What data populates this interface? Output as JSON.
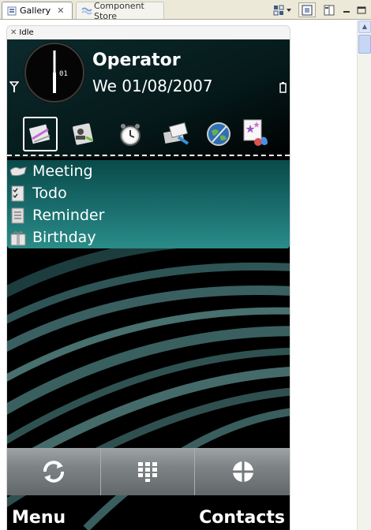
{
  "tabs": [
    {
      "label": "Gallery",
      "icon": "gallery-icon",
      "active": true
    },
    {
      "label": "Component Store",
      "icon": "component-store-icon",
      "active": false
    }
  ],
  "frame": {
    "title": "Idle"
  },
  "phone": {
    "operator": "Operator",
    "date": "We 01/08/2007",
    "shortcuts": [
      {
        "name": "notes-shortcut",
        "icon": "notes-icon",
        "selected": true
      },
      {
        "name": "contacts-shortcut",
        "icon": "address-book-icon",
        "selected": false
      },
      {
        "name": "clock-shortcut",
        "icon": "alarm-clock-icon",
        "selected": false
      },
      {
        "name": "messaging-shortcut",
        "icon": "messaging-icon",
        "selected": false
      },
      {
        "name": "web-shortcut",
        "icon": "globe-icon",
        "selected": false
      },
      {
        "name": "gallery-shortcut",
        "icon": "stars-icon",
        "selected": false
      }
    ],
    "events": [
      {
        "label": "Meeting",
        "icon": "meeting-icon"
      },
      {
        "label": "Todo",
        "icon": "todo-icon"
      },
      {
        "label": "Reminder",
        "icon": "reminder-icon"
      },
      {
        "label": "Birthday",
        "icon": "birthday-icon"
      }
    ],
    "softbar": [
      {
        "name": "cycle-button",
        "icon": "cycle-icon"
      },
      {
        "name": "dialpad-button",
        "icon": "dialpad-icon"
      },
      {
        "name": "navigation-button",
        "icon": "crosshair-icon"
      }
    ],
    "softkeys": {
      "left": "Menu",
      "right": "Contacts"
    }
  },
  "colors": {
    "screen_background": "#000000",
    "events_panel": "#1a6e6e",
    "softbar": "#7e8486",
    "text": "#ffffff"
  }
}
